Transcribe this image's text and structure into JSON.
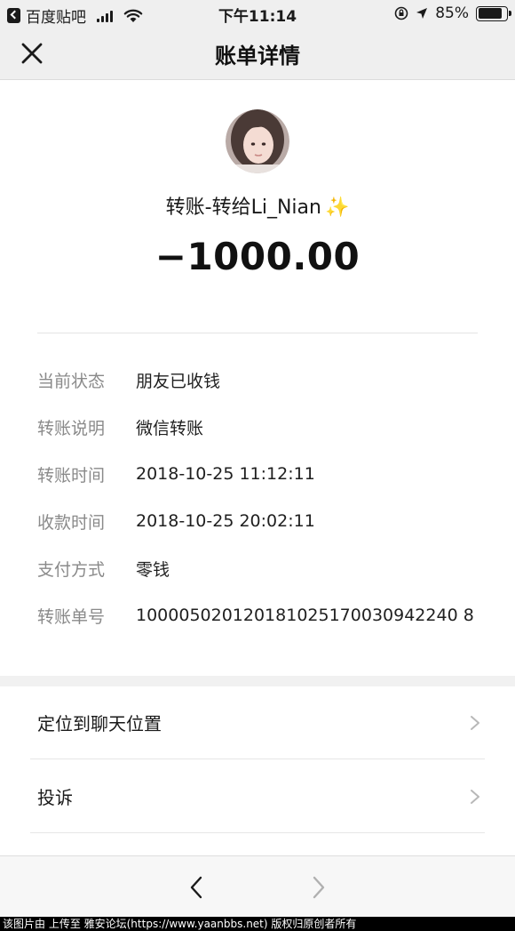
{
  "status_bar": {
    "back_app": "百度贴吧",
    "time": "下午11:14",
    "battery": "85%",
    "battery_level": 0.85
  },
  "nav": {
    "title": "账单详情",
    "close_icon": "close-icon"
  },
  "header": {
    "payee": "转账-转给Li_Nian",
    "sparkle": "✨",
    "amount": "−1000.00"
  },
  "details": [
    {
      "label": "当前状态",
      "value": "朋友已收钱"
    },
    {
      "label": "转账说明",
      "value": "微信转账"
    },
    {
      "label": "转账时间",
      "value": "2018-10-25 11:12:11"
    },
    {
      "label": "收款时间",
      "value": "2018-10-25 20:02:11"
    },
    {
      "label": "支付方式",
      "value": "零钱"
    },
    {
      "label": "转账单号",
      "value": "100005020120181025170030942240 8"
    }
  ],
  "actions": [
    {
      "label": "定位到聊天位置"
    },
    {
      "label": "投诉"
    }
  ],
  "toolbar": {
    "back_icon": "chevron-left-icon",
    "forward_icon": "chevron-right-icon"
  },
  "watermark": "该图片由  上传至 雅安论坛(https://www.yaanbbs.net) 版权归原创者所有"
}
